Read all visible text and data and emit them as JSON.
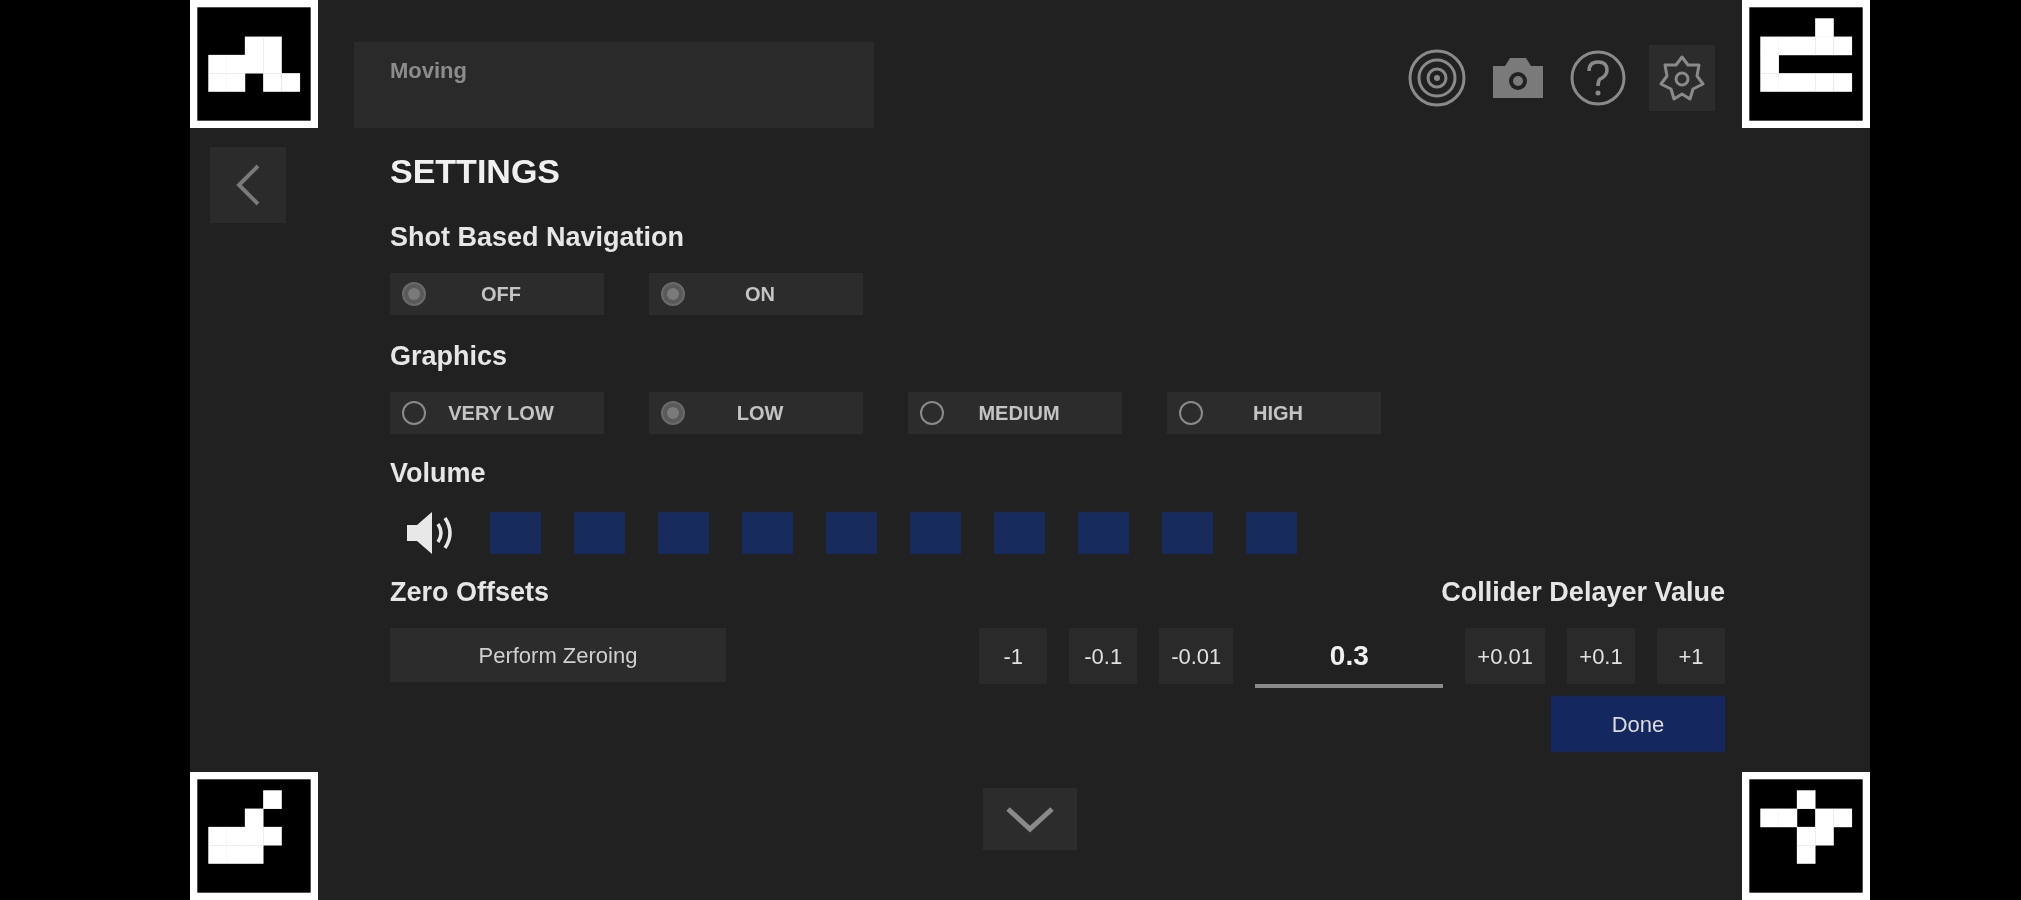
{
  "header": {
    "mode_label": "Moving"
  },
  "title": "SETTINGS",
  "shot_based_navigation": {
    "label": "Shot Based Navigation",
    "options": [
      {
        "label": "OFF",
        "selected": true
      },
      {
        "label": "ON",
        "selected": true
      }
    ]
  },
  "graphics": {
    "label": "Graphics",
    "options": [
      {
        "label": "VERY LOW",
        "selected": false
      },
      {
        "label": "LOW",
        "selected": true
      },
      {
        "label": "MEDIUM",
        "selected": false
      },
      {
        "label": "HIGH",
        "selected": false
      }
    ]
  },
  "volume": {
    "label": "Volume",
    "segments": [
      {
        "on": true
      },
      {
        "on": true
      },
      {
        "on": true
      },
      {
        "on": true
      },
      {
        "on": true
      },
      {
        "on": true
      },
      {
        "on": true
      },
      {
        "on": true
      },
      {
        "on": true
      },
      {
        "on": true
      }
    ]
  },
  "zero_offsets": {
    "label": "Zero Offsets",
    "button": "Perform Zeroing"
  },
  "collider_delayer": {
    "label": "Collider Delayer Value",
    "decrements": [
      "-1",
      "-0.1",
      "-0.01"
    ],
    "value": "0.3",
    "increments": [
      "+0.01",
      "+0.1",
      "+1"
    ],
    "done": "Done"
  }
}
